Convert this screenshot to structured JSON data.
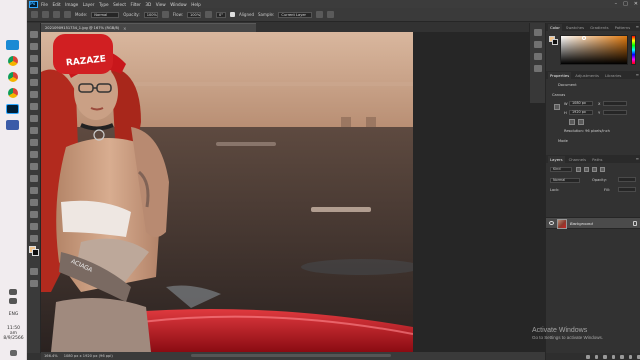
{
  "taskbar": {
    "icons": [
      "edge-icon",
      "chrome-icon",
      "photoshop-icon",
      "folder-icon",
      "settings-icon"
    ],
    "language": "ENG",
    "time": "11:50",
    "period": "am",
    "date": "8/9/2566"
  },
  "app": {
    "logo": "Ps",
    "menu": [
      "File",
      "Edit",
      "Image",
      "Layer",
      "Type",
      "Select",
      "Filter",
      "3D",
      "View",
      "Window",
      "Help"
    ],
    "window_controls": [
      "–",
      "□",
      "✕"
    ]
  },
  "options_bar": {
    "mode_label": "Mode:",
    "mode_value": "Normal",
    "opacity_label": "Opacity:",
    "opacity_value": "100%",
    "flow_label": "Flow:",
    "flow_value": "100%",
    "angle_value": "0°",
    "align_label": "Aligned",
    "sample_label": "Sample:",
    "sample_value": "Current Layer"
  },
  "document": {
    "tab_title": "20210909151734_1.jpg @ 167% (RGB/8)",
    "zoom": "166.4%",
    "doc_info": "1080 px x 1920 px (96 ppi)"
  },
  "panels": {
    "color_tabs": [
      "Color",
      "Swatches",
      "Gradients",
      "Patterns"
    ],
    "properties_tabs": [
      "Properties",
      "Adjustments",
      "Libraries"
    ],
    "properties": {
      "kind": "Document",
      "section": "Canvas",
      "width_label": "W",
      "width_value": "1080 px",
      "height_label": "H",
      "height_value": "1920 px",
      "x_label": "X",
      "y_label": "Y",
      "resolution": "Resolution: 96 pixels/inch",
      "mode_label": "Mode"
    },
    "layers_tabs": [
      "Layers",
      "Channels",
      "Paths"
    ],
    "layers": {
      "kind_filter": "Kind",
      "blend_mode": "Normal",
      "opacity_label": "Opacity:",
      "lock_label": "Lock:",
      "fill_label": "Fill:",
      "items": [
        {
          "name": "Background"
        }
      ]
    }
  },
  "watermark": {
    "title": "Activate Windows",
    "subtitle": "Go to Settings to activate Windows."
  },
  "hat_text": "RAZAZE",
  "bag_text": "ACIAGA",
  "colors": {
    "foreground": "#f2c38c",
    "background": "#111111",
    "photoshop_blue": "#31a8ff",
    "hat_red": "#c8171b",
    "car_red": "#b5101a"
  }
}
